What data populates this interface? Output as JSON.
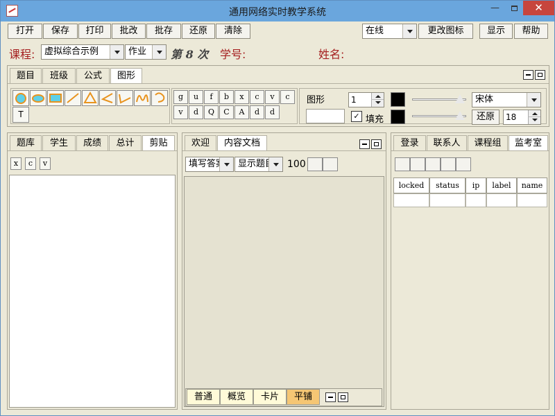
{
  "window": {
    "title": "通用网络实时教学系统"
  },
  "toolbar": {
    "buttons": [
      "打开",
      "保存",
      "打印",
      "批改",
      "批存",
      "还原",
      "清除"
    ],
    "status_combo": "在线",
    "change_icon": "更改图标",
    "show": "显示",
    "help": "帮助"
  },
  "course": {
    "label": "课程:",
    "course_value": "虚拟综合示例",
    "type_value": "作业",
    "session": "第 8 次",
    "student_no": "学号:",
    "name": "姓名:"
  },
  "tools": {
    "tabs": [
      "题目",
      "班级",
      "公式",
      "图形"
    ],
    "active_tab": "图形",
    "shapes": [
      "circle",
      "ellipse",
      "rectangle",
      "line",
      "triangle",
      "angle",
      "polyline",
      "wave",
      "arc"
    ],
    "text_tool": "T",
    "letters_row1": [
      "g",
      "u",
      "f",
      "b",
      "x",
      "c",
      "v",
      "c"
    ],
    "letters_row2": [
      "v",
      "d",
      "Q",
      "C",
      "A",
      "d",
      "d"
    ],
    "shape_label": "图形",
    "line_width": "1",
    "fill_label": "填充",
    "fill_checked": "✓",
    "font": "宋体",
    "restore": "还原",
    "font_size": "18",
    "colors": {
      "line": "#000000",
      "fill": "#000000"
    }
  },
  "left_panel": {
    "tabs": [
      "题库",
      "学生",
      "成绩",
      "总计",
      "剪贴"
    ],
    "active_tab": "剪贴",
    "buttons": [
      "x",
      "c",
      "v"
    ]
  },
  "center_panel": {
    "tabs": [
      "欢迎",
      "内容文档"
    ],
    "active_tab": "内容文档",
    "combo1": "填写答案",
    "combo2": "显示题目",
    "zoom": "100",
    "view_tabs": [
      "普通",
      "概览",
      "卡片",
      "平铺"
    ],
    "active_view": "平铺"
  },
  "right_panel": {
    "tabs": [
      "登录",
      "联系人",
      "课程组",
      "监考室"
    ],
    "active_tab": "监考室",
    "columns": [
      "locked",
      "status",
      "ip",
      "label",
      "name"
    ]
  }
}
